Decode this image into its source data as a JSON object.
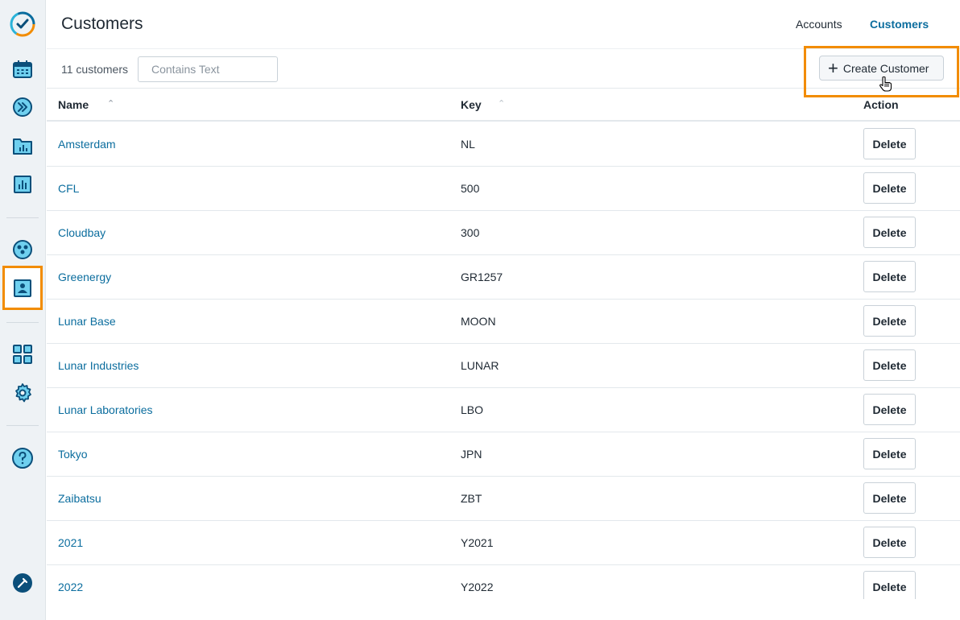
{
  "app": {
    "accent": "#0b6d9e",
    "highlight": "#f28c00"
  },
  "sidebar": {
    "icons": [
      "logo-check-icon",
      "calendar-icon",
      "fast-forward-icon",
      "folder-chart-icon",
      "bar-chart-icon",
      "team-icon",
      "customer-icon",
      "apps-grid-icon",
      "gear-icon",
      "help-icon",
      "pin-icon"
    ],
    "active": "customer-icon"
  },
  "header": {
    "title": "Customers",
    "nav": [
      {
        "label": "Accounts",
        "active": false
      },
      {
        "label": "Customers",
        "active": true
      }
    ]
  },
  "toolbar": {
    "count_label": "11 customers",
    "filter_placeholder": "Contains Text",
    "filter_value": "",
    "create_label": "Create Customer"
  },
  "table": {
    "columns": {
      "name": "Name",
      "key": "Key",
      "action": "Action"
    },
    "delete_label": "Delete",
    "rows": [
      {
        "name": "Amsterdam",
        "key": "NL"
      },
      {
        "name": "CFL",
        "key": "500"
      },
      {
        "name": "Cloudbay",
        "key": "300"
      },
      {
        "name": "Greenergy",
        "key": "GR1257"
      },
      {
        "name": "Lunar Base",
        "key": "MOON"
      },
      {
        "name": "Lunar Industries",
        "key": "LUNAR"
      },
      {
        "name": "Lunar Laboratories",
        "key": "LBO"
      },
      {
        "name": "Tokyo",
        "key": "JPN"
      },
      {
        "name": "Zaibatsu",
        "key": "ZBT"
      },
      {
        "name": "2021",
        "key": "Y2021"
      },
      {
        "name": "2022",
        "key": "Y2022"
      }
    ]
  }
}
